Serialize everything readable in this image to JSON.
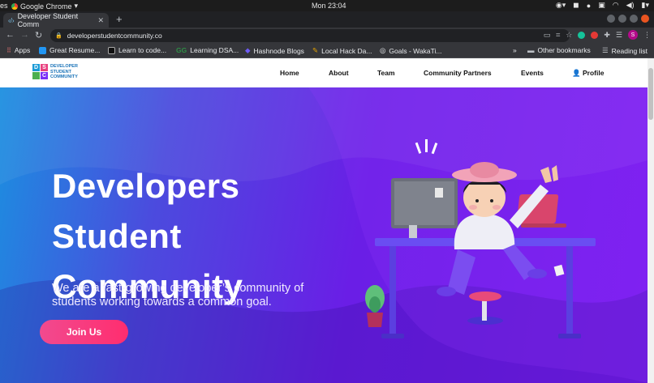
{
  "os": {
    "activities": "es",
    "app_name": "Google Chrome",
    "clock": "Mon 23:04"
  },
  "browser": {
    "tab_title": "Developer Student Comm",
    "url": "developerstudentcommunity.co",
    "profile_initial": "S"
  },
  "bookmarks": {
    "items": [
      "Apps",
      "Great Resume...",
      "Learn to code...",
      "Learning DSA...",
      "Hashnode Blogs",
      "Local Hack Da...",
      "Goals - WakaTi..."
    ],
    "overflow": "»",
    "other": "Other bookmarks",
    "reading_list": "Reading list"
  },
  "site": {
    "logo_letters": [
      "D",
      "S",
      "",
      "C"
    ],
    "logo_text": [
      "DEVELOPER",
      "STUDENT",
      "COMMUNITY"
    ],
    "nav": [
      "Home",
      "About",
      "Team",
      "Community Partners",
      "Events",
      "Profile"
    ],
    "hero": {
      "title_lines": [
        "Developers",
        "Student",
        "Community"
      ],
      "subtitle": "We are a fast-growing developer’s community of students working towards a common goal.",
      "cta": "Join Us"
    }
  },
  "colors": {
    "logo": [
      "#1a9ad6",
      "#e8417f",
      "#4caf50",
      "#7b2ff7"
    ],
    "cta": "#ff2d6f"
  }
}
